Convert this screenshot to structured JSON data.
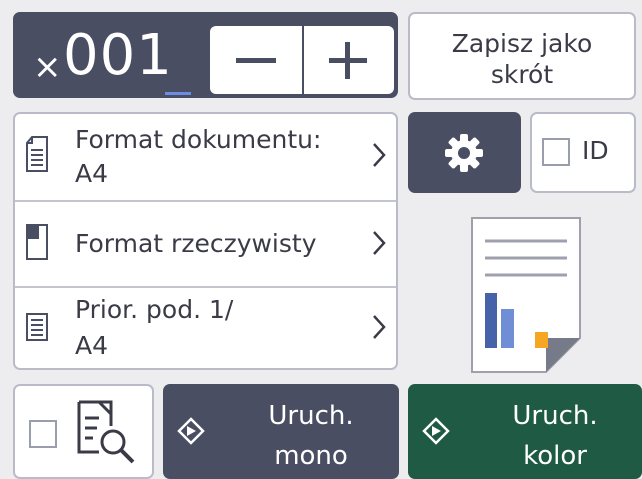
{
  "copies": {
    "prefix": "×",
    "count": "001",
    "minus_icon": "minus-icon",
    "plus_icon": "plus-icon"
  },
  "shortcut": {
    "line1": "Zapisz jako",
    "line2": "skrót"
  },
  "settings": [
    {
      "icon": "document-size-icon",
      "line1": "Format dokumentu:",
      "line2": "A4"
    },
    {
      "icon": "actual-size-icon",
      "line1": "Format rzeczywisty",
      "line2": ""
    },
    {
      "icon": "tray-priority-icon",
      "line1": "Prior. pod. 1/",
      "line2": "A4"
    }
  ],
  "gear": {
    "icon": "gear-icon"
  },
  "id_copy": {
    "label": "ID",
    "checked": false
  },
  "preview": {
    "icon": "preview-magnify-icon",
    "checked": false
  },
  "start_mono": {
    "line1": "Uruch.",
    "line2": "mono",
    "icon": "start-diamond-icon"
  },
  "start_color": {
    "line1": "Uruch.",
    "line2": "kolor",
    "icon": "start-diamond-icon"
  },
  "colors": {
    "background": "#ededf0",
    "dark_button": "#4a4e63",
    "start_color_button": "#1e5a44",
    "border": "#b9bcc8",
    "cursor_underline": "#6b8de6",
    "chart_blue": "#4662a8",
    "chart_orange": "#f5a623"
  }
}
